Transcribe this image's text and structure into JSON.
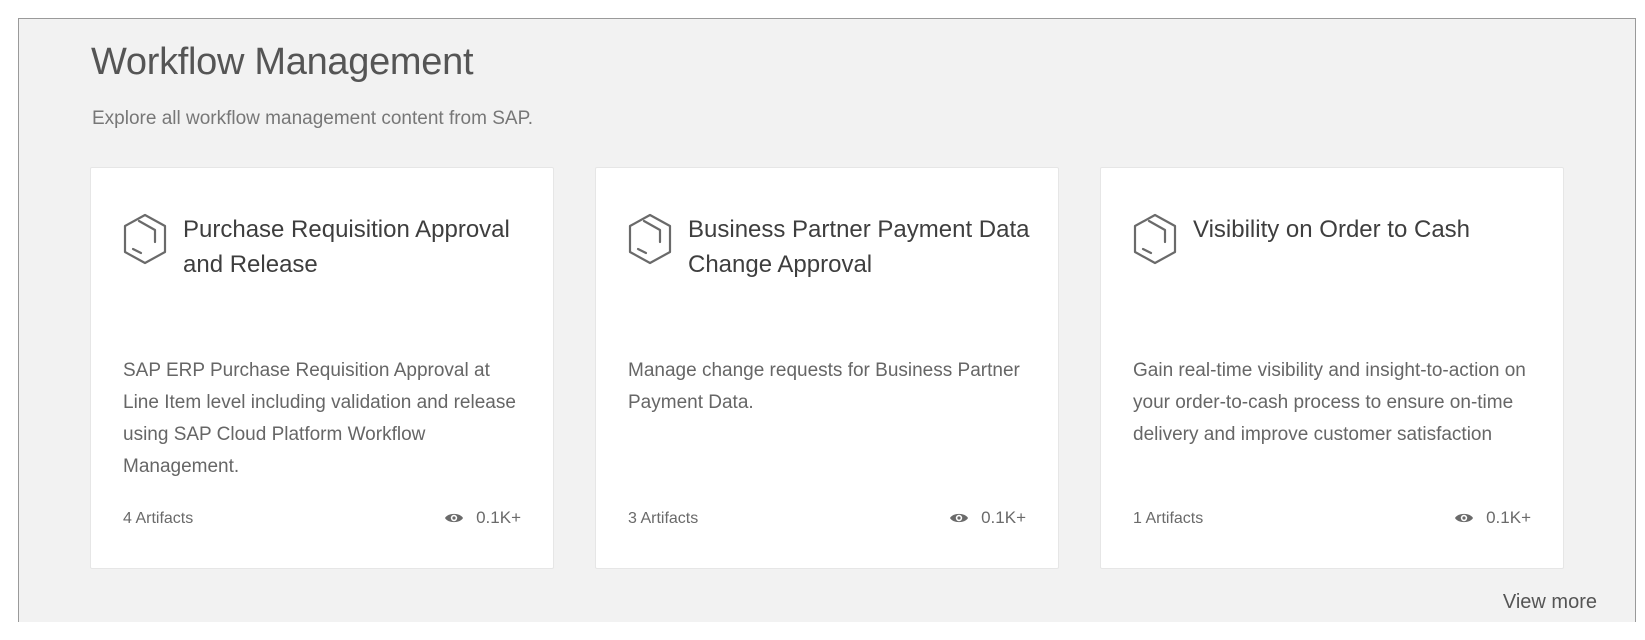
{
  "section": {
    "title": "Workflow Management",
    "subtitle": "Explore all workflow management content from SAP."
  },
  "cards": [
    {
      "icon": "package-icon",
      "title": "Purchase Requisition Approval and Release",
      "description": "SAP ERP Purchase Requisition Approval at Line Item level including validation and release using SAP Cloud Platform Workflow Management.",
      "artifacts": "4 Artifacts",
      "views": "0.1K+"
    },
    {
      "icon": "package-icon",
      "title": "Business Partner Payment Data Change Approval",
      "description": "Manage change requests for Business Partner Payment Data.",
      "artifacts": "3 Artifacts",
      "views": "0.1K+"
    },
    {
      "icon": "package-icon",
      "title": "Visibility on Order to Cash",
      "description": "Gain real-time visibility and insight-to-action on your order-to-cash process to ensure on-time delivery and improve customer satisfaction",
      "artifacts": "1 Artifacts",
      "views": "0.1K+"
    }
  ],
  "view_more_label": "View more",
  "colors": {
    "panel_background": "#f2f2f2",
    "card_background": "#ffffff",
    "text": "#555555"
  }
}
